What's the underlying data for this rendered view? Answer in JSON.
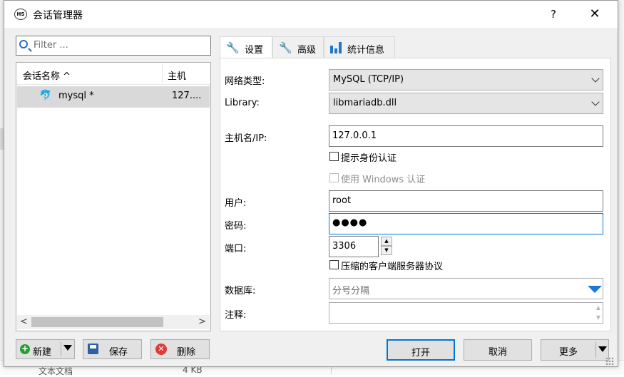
{
  "window": {
    "title": "会话管理器",
    "icon_text": "HS",
    "help_label": "?",
    "close_label": "✕"
  },
  "left": {
    "filter_placeholder": "Filter ...",
    "columns": [
      "会话名称 ^",
      "主机"
    ],
    "sessions": [
      {
        "name": "mysql *",
        "host": "127...."
      }
    ],
    "scroll_left": "<",
    "scroll_right": ">",
    "buttons": {
      "new": "新建",
      "save": "保存",
      "delete": "删除"
    }
  },
  "tabs": [
    {
      "label": "设置",
      "icon": "wrench-icon"
    },
    {
      "label": "高级",
      "icon": "wrench-orange-icon"
    },
    {
      "label": "统计信息",
      "icon": "bar-chart-icon"
    }
  ],
  "settings": {
    "network_type_label": "网络类型:",
    "network_type_value": "MySQL (TCP/IP)",
    "library_label": "Library:",
    "library_value": "libmariadb.dll",
    "hostname_label": "主机名/IP:",
    "hostname_value": "127.0.0.1",
    "prompt_auth_label": "提示身份认证",
    "windows_auth_label": "使用 Windows 认证",
    "user_label": "用户:",
    "user_value": "root",
    "password_label": "密码:",
    "password_value": "●●●●",
    "port_label": "端口:",
    "port_value": "3306",
    "compress_label": "压缩的客户端服务器协议",
    "database_label": "数据库:",
    "database_placeholder": "分号分隔",
    "comment_label": "注释:"
  },
  "footer": {
    "open": "打开",
    "cancel": "取消",
    "more": "更多"
  },
  "background": {
    "file_type": "文本文档",
    "file_size": "4 KB"
  },
  "colors": {
    "accent": "#0078d7",
    "dropdown_blue": "#1e78d2",
    "selected_row": "#d9d9d9"
  }
}
